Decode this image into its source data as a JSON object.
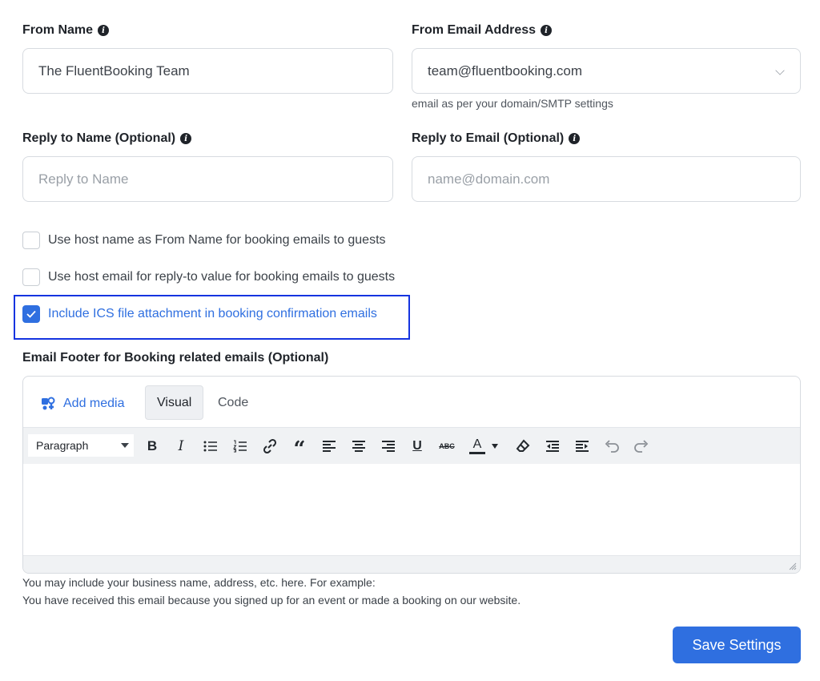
{
  "from_name": {
    "label": "From Name",
    "value": "The FluentBooking Team"
  },
  "from_email": {
    "label": "From Email Address",
    "value": "team@fluentbooking.com",
    "help": "email as per your domain/SMTP settings"
  },
  "reply_name": {
    "label": "Reply to Name (Optional)",
    "placeholder": "Reply to Name"
  },
  "reply_email": {
    "label": "Reply to Email (Optional)",
    "placeholder": "name@domain.com"
  },
  "options": [
    {
      "label": "Use host name as From Name for booking emails to guests",
      "checked": false
    },
    {
      "label": "Use host email for reply-to value for booking emails to guests",
      "checked": false
    },
    {
      "label": "Include ICS file attachment in booking confirmation emails",
      "checked": true
    }
  ],
  "footer": {
    "label": "Email Footer for Booking related emails (Optional)",
    "add_media": "Add media",
    "tabs": [
      "Visual",
      "Code"
    ],
    "active_tab": "Visual",
    "format_select": "Paragraph",
    "toolbar_icons": [
      "bold-icon",
      "italic-icon",
      "bullet-list-icon",
      "numbered-list-icon",
      "link-icon",
      "blockquote-icon",
      "align-left-icon",
      "align-center-icon",
      "align-right-icon",
      "underline-icon",
      "strikethrough-icon",
      "text-color-icon",
      "clear-formatting-icon",
      "outdent-icon",
      "indent-icon",
      "undo-icon",
      "redo-icon"
    ],
    "note_line1": "You may include your business name, address, etc. here. For example:",
    "note_line2": "You have received this email because you signed up for an event or made a booking on our website."
  },
  "save_label": "Save Settings",
  "colors": {
    "accent": "#2f6fe0",
    "highlight_border": "#1534e0"
  }
}
